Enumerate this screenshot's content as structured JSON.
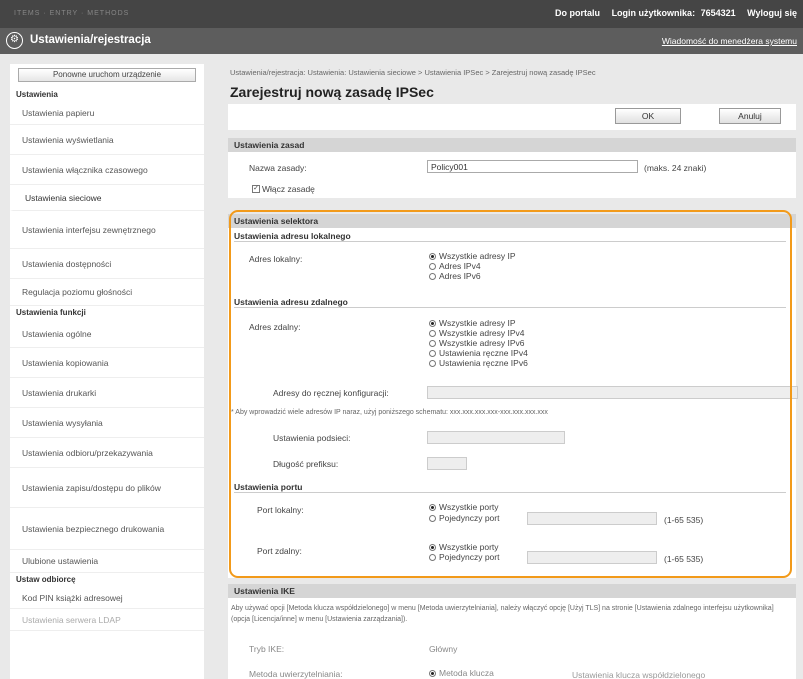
{
  "top": {
    "blurred_title": "ITEMS · ENTRY · METHODS",
    "portal_link": "Do portalu",
    "login_label": "Login użytkownika:",
    "login_value": "7654321",
    "logout_link": "Wyloguj się"
  },
  "header": {
    "title": "Ustawienia/rejestracja",
    "message_link": "Wiadomość do menedżera systemu"
  },
  "sidebar": {
    "restart_button": "Ponowne uruchom urządzenie",
    "section_settings": "Ustawienia",
    "items_settings": [
      "Ustawienia papieru",
      "Ustawienia wyświetlania",
      "Ustawienia włącznika czasowego",
      "Ustawienia sieciowe",
      "Ustawienia interfejsu zewnętrznego",
      "Ustawienia dostępności",
      "Regulacja poziomu głośności"
    ],
    "section_functions": "Ustawienia funkcji",
    "items_functions": [
      "Ustawienia ogólne",
      "Ustawienia kopiowania",
      "Ustawienia drukarki",
      "Ustawienia wysyłania",
      "Ustawienia odbioru/przekazywania",
      "Ustawienia zapisu/dostępu do plików",
      "Ustawienia bezpiecznego drukowania",
      "Ulubione ustawienia"
    ],
    "section_recipients": "Ustaw odbiorcę",
    "items_recipients": [
      "Kod PIN książki adresowej",
      "Ustawienia serwera LDAP"
    ]
  },
  "main": {
    "breadcrumb": "Ustawienia/rejestracja: Ustawienia: Ustawienia sieciowe > Ustawienia IPSec > Zarejestruj nową zasadę IPSec",
    "title": "Zarejestruj nową zasadę IPSec",
    "ok_button": "OK",
    "cancel_button": "Anuluj",
    "policy": {
      "header": "Ustawienia zasad",
      "name_label": "Nazwa zasady:",
      "name_value": "Policy001",
      "name_hint": "(maks. 24 znaki)",
      "enable_label": "Włącz zasadę",
      "enable_checked": true
    },
    "selector": {
      "header": "Ustawienia selektora",
      "local_head": "Ustawienia adresu lokalnego",
      "local_label": "Adres lokalny:",
      "local_options": [
        "Wszystkie adresy IP",
        "Adres IPv4",
        "Adres IPv6"
      ],
      "local_selected": 0,
      "remote_head": "Ustawienia adresu zdalnego",
      "remote_label": "Adres zdalny:",
      "remote_options": [
        "Wszystkie adresy IP",
        "Wszystkie adresy IPv4",
        "Wszystkie adresy IPv6",
        "Ustawienia ręczne IPv4",
        "Ustawienia ręczne IPv6"
      ],
      "remote_selected": 0,
      "manual_label": "Adresy do ręcznej konfiguracji:",
      "note": "* Aby wprowadzić wiele adresów IP naraz, użyj poniższego schematu: xxx.xxx.xxx.xxx-xxx.xxx.xxx.xxx",
      "subnet_label": "Ustawienia podsieci:",
      "prefix_label": "Długość prefiksu:",
      "port_head": "Ustawienia portu",
      "local_port_label": "Port lokalny:",
      "remote_port_label": "Port zdalny:",
      "port_options": [
        "Wszystkie porty",
        "Pojedynczy port"
      ],
      "port_range": "(1-65 535)"
    },
    "ike": {
      "header": "Ustawienia IKE",
      "description": "Aby używać opcji [Metoda klucza współdzielonego] w menu [Metoda uwierzytelniania], należy włączyć opcję [Użyj TLS] na stronie [Ustawienia zdalnego interfejsu użytkownika] (opcja [Licencja/inne] w menu [Ustawienia zarządzania]).",
      "mode_label": "Tryb IKE:",
      "mode_value": "Główny",
      "auth_label": "Metoda uwierzytelniania:",
      "auth_value": "Metoda klucza",
      "shared_key_link": "Ustawienia klucza współdzielonego"
    }
  }
}
